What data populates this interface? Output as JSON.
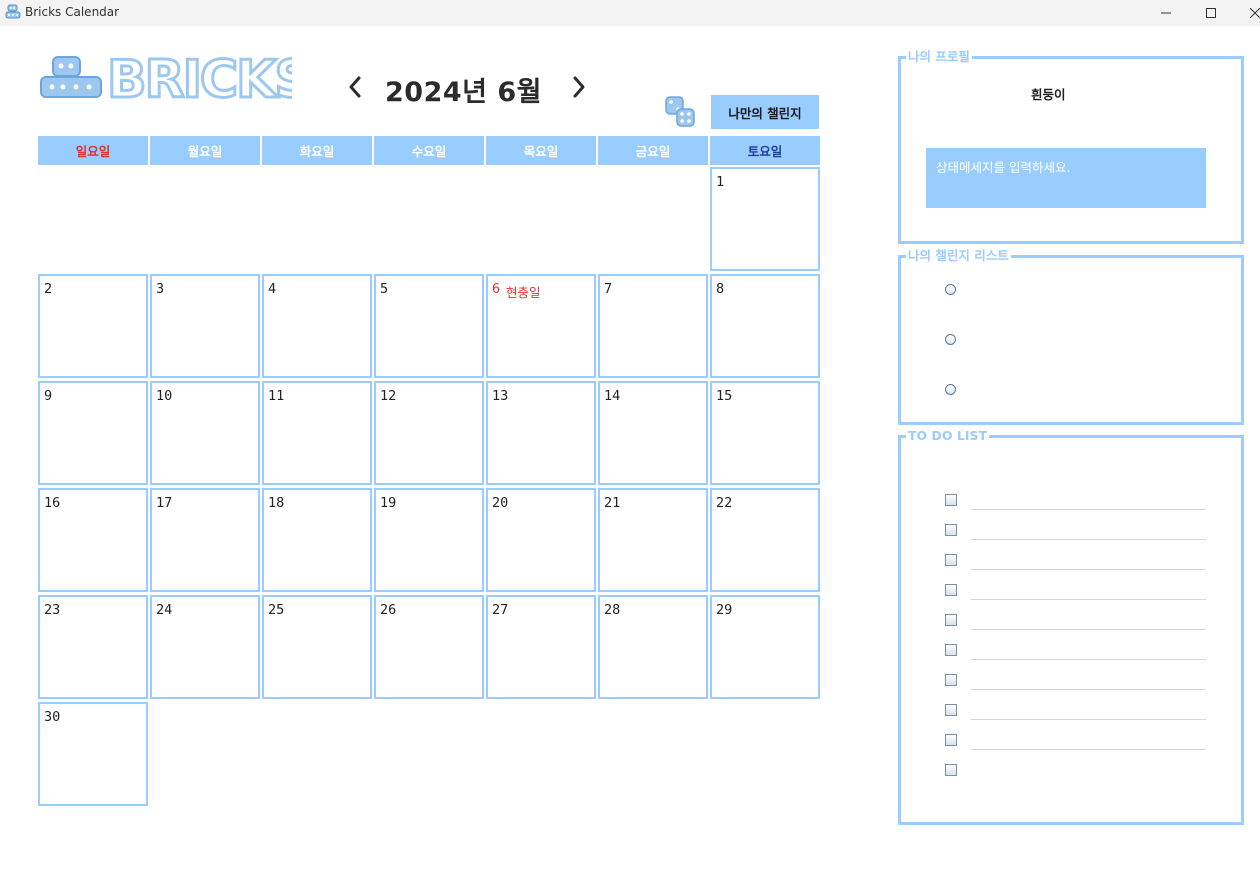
{
  "window": {
    "title": "Bricks Calendar"
  },
  "header": {
    "logo_text": "BRICKS",
    "month_title": "2024년 6월",
    "prev_icon": "chevron-left-icon",
    "next_icon": "chevron-right-icon",
    "challenge_button": "나만의 챌린지",
    "dice_icon": "dice-icon"
  },
  "weekdays": [
    "일요일",
    "월요일",
    "화요일",
    "수요일",
    "목요일",
    "금요일",
    "토요일"
  ],
  "calendar": {
    "days": [
      "1",
      "2",
      "3",
      "4",
      "5",
      "6",
      "7",
      "8",
      "9",
      "10",
      "11",
      "12",
      "13",
      "14",
      "15",
      "16",
      "17",
      "18",
      "19",
      "20",
      "21",
      "22",
      "23",
      "24",
      "25",
      "26",
      "27",
      "28",
      "29",
      "30"
    ],
    "holiday": {
      "day": "6",
      "name": "현충일"
    }
  },
  "profile": {
    "legend": "나의 프로필",
    "nickname": "흰둥이",
    "status_placeholder": "상태메세지를 입력하세요."
  },
  "challenges": {
    "legend": "나의 챌린지 리스트",
    "items": [
      "",
      "",
      ""
    ]
  },
  "todo": {
    "legend": "TO DO LIST",
    "items": [
      "",
      "",
      "",
      "",
      "",
      "",
      "",
      "",
      "",
      ""
    ]
  },
  "colors": {
    "accent": "#99ccff",
    "sunday": "#e0312f",
    "saturday": "#1f3f9e",
    "holiday": "#e0312f"
  }
}
